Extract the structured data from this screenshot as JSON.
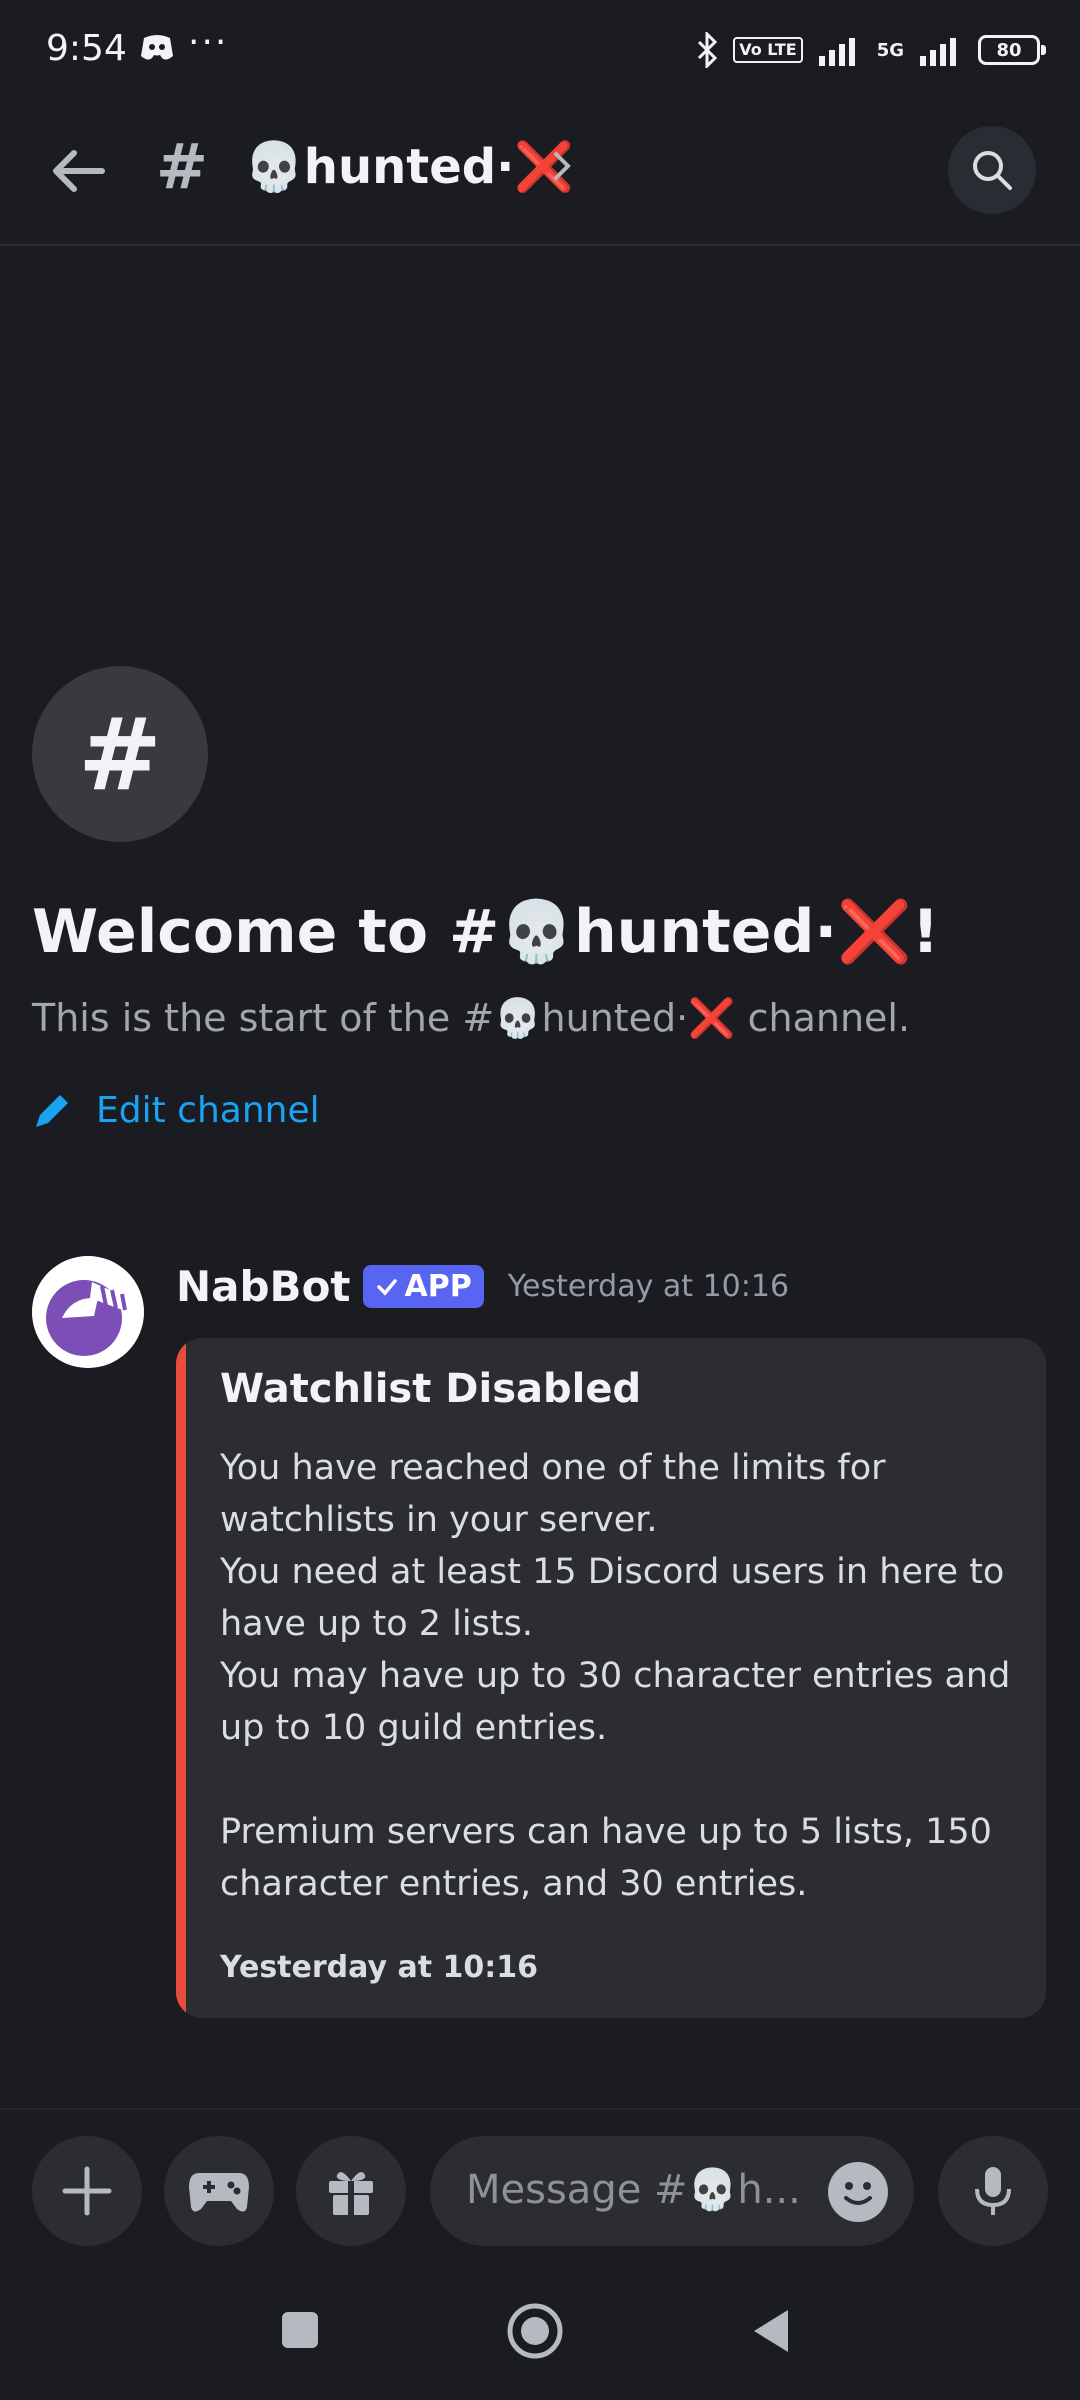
{
  "status_bar": {
    "time": "9:54",
    "dots": "···",
    "network": "5G",
    "volte": "Vo LTE",
    "battery": "80"
  },
  "header": {
    "hash": "#",
    "channel_name": "💀hunted·❌"
  },
  "welcome": {
    "icon_symbol": "#",
    "title": "Welcome to #💀hunted·❌!",
    "subtitle": "This is the start of the #💀hunted·❌ channel.",
    "edit_label": "Edit channel"
  },
  "message": {
    "author": "NabBot",
    "badge": "APP",
    "timestamp": "Yesterday at 10:16",
    "embed": {
      "title": "Watchlist Disabled",
      "lines": [
        "You have reached one of the limits for watchlists in your server.",
        "You need at least 15 Discord users in here to have up to 2 lists.",
        "You may have up to 30 character entries and up to 10 guild entries."
      ],
      "premium": "Premium servers can have up to 5 lists, 150 character entries, and 30 entries.",
      "footer": "Yesterday at 10:16",
      "accent_color": "#e74c3c"
    }
  },
  "composer": {
    "placeholder": "Message #💀h..."
  }
}
